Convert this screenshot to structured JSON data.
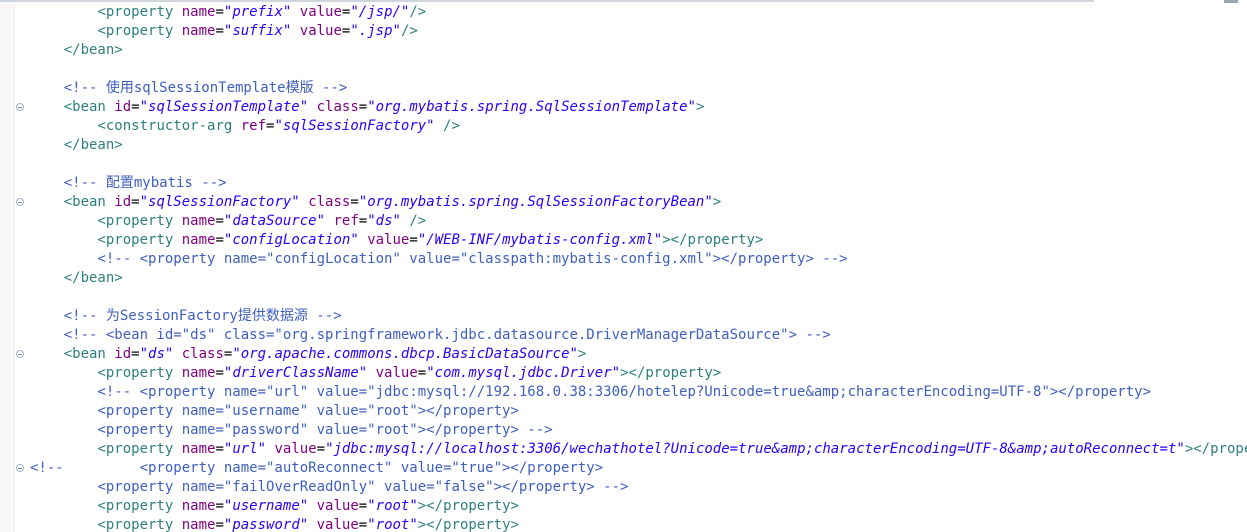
{
  "editor": {
    "lines": [
      {
        "kind": "prop",
        "indent": "        ",
        "name": "prefix",
        "value": "/jsp/"
      },
      {
        "kind": "prop",
        "indent": "        ",
        "name": "suffix",
        "value": ".jsp"
      },
      {
        "kind": "close",
        "indent": "    ",
        "tag": "</bean>"
      },
      {
        "kind": "blank"
      },
      {
        "kind": "comment",
        "indent": "    ",
        "text": "<!-- 使用sqlSessionTemplate模版 -->"
      },
      {
        "kind": "bean",
        "fold": true,
        "indent": "    ",
        "id": "sqlSessionTemplate",
        "class": "org.mybatis.spring.SqlSessionTemplate"
      },
      {
        "kind": "carg",
        "indent": "        ",
        "ref": "sqlSessionFactory"
      },
      {
        "kind": "close",
        "indent": "    ",
        "tag": "</bean>"
      },
      {
        "kind": "blank"
      },
      {
        "kind": "comment",
        "indent": "    ",
        "text": "<!-- 配置mybatis -->"
      },
      {
        "kind": "bean",
        "fold": true,
        "indent": "    ",
        "id": "sqlSessionFactory",
        "class": "org.mybatis.spring.SqlSessionFactoryBean"
      },
      {
        "kind": "propref",
        "indent": "        ",
        "name": "dataSource",
        "ref": "ds"
      },
      {
        "kind": "propfull",
        "indent": "        ",
        "name": "configLocation",
        "value": "/WEB-INF/mybatis-config.xml"
      },
      {
        "kind": "comment",
        "indent": "        ",
        "text": "<!-- <property name=\"configLocation\" value=\"classpath:mybatis-config.xml\"></property> -->"
      },
      {
        "kind": "close",
        "indent": "    ",
        "tag": "</bean>"
      },
      {
        "kind": "blank"
      },
      {
        "kind": "comment",
        "indent": "    ",
        "text": "<!-- 为SessionFactory提供数据源 -->"
      },
      {
        "kind": "comment",
        "indent": "    ",
        "text": "<!-- <bean id=\"ds\" class=\"org.springframework.jdbc.datasource.DriverManagerDataSource\"> -->"
      },
      {
        "kind": "bean",
        "fold": true,
        "indent": "    ",
        "id": "ds",
        "class": "org.apache.commons.dbcp.BasicDataSource"
      },
      {
        "kind": "propfull",
        "indent": "        ",
        "name": "driverClassName",
        "value": "com.mysql.jdbc.Driver"
      },
      {
        "kind": "comment",
        "indent": "        ",
        "text": "<!-- <property name=\"url\" value=\"jdbc:mysql://192.168.0.38:3306/hotelep?Unicode=true&amp;characterEncoding=UTF-8\"></property>"
      },
      {
        "kind": "comment",
        "indent": "        ",
        "text": "<property name=\"username\" value=\"root\"></property>"
      },
      {
        "kind": "comment",
        "indent": "        ",
        "text": "<property name=\"password\" value=\"root\"></property> -->"
      },
      {
        "kind": "propfull",
        "indent": "        ",
        "name": "url",
        "value": "jdbc:mysql://localhost:3306/wechathotel?Unicode=true&amp;characterEncoding=UTF-8&amp;autoReconnect=t"
      },
      {
        "kind": "commentfold",
        "fold": true,
        "text": "<!--         <property name=\"autoReconnect\" value=\"true\"></property>"
      },
      {
        "kind": "comment",
        "indent": "        ",
        "text": "<property name=\"failOverReadOnly\" value=\"false\"></property> -->"
      },
      {
        "kind": "propfull",
        "indent": "        ",
        "name": "username",
        "value": "root"
      },
      {
        "kind": "propfull",
        "indent": "        ",
        "name": "password",
        "value": "root"
      }
    ]
  }
}
